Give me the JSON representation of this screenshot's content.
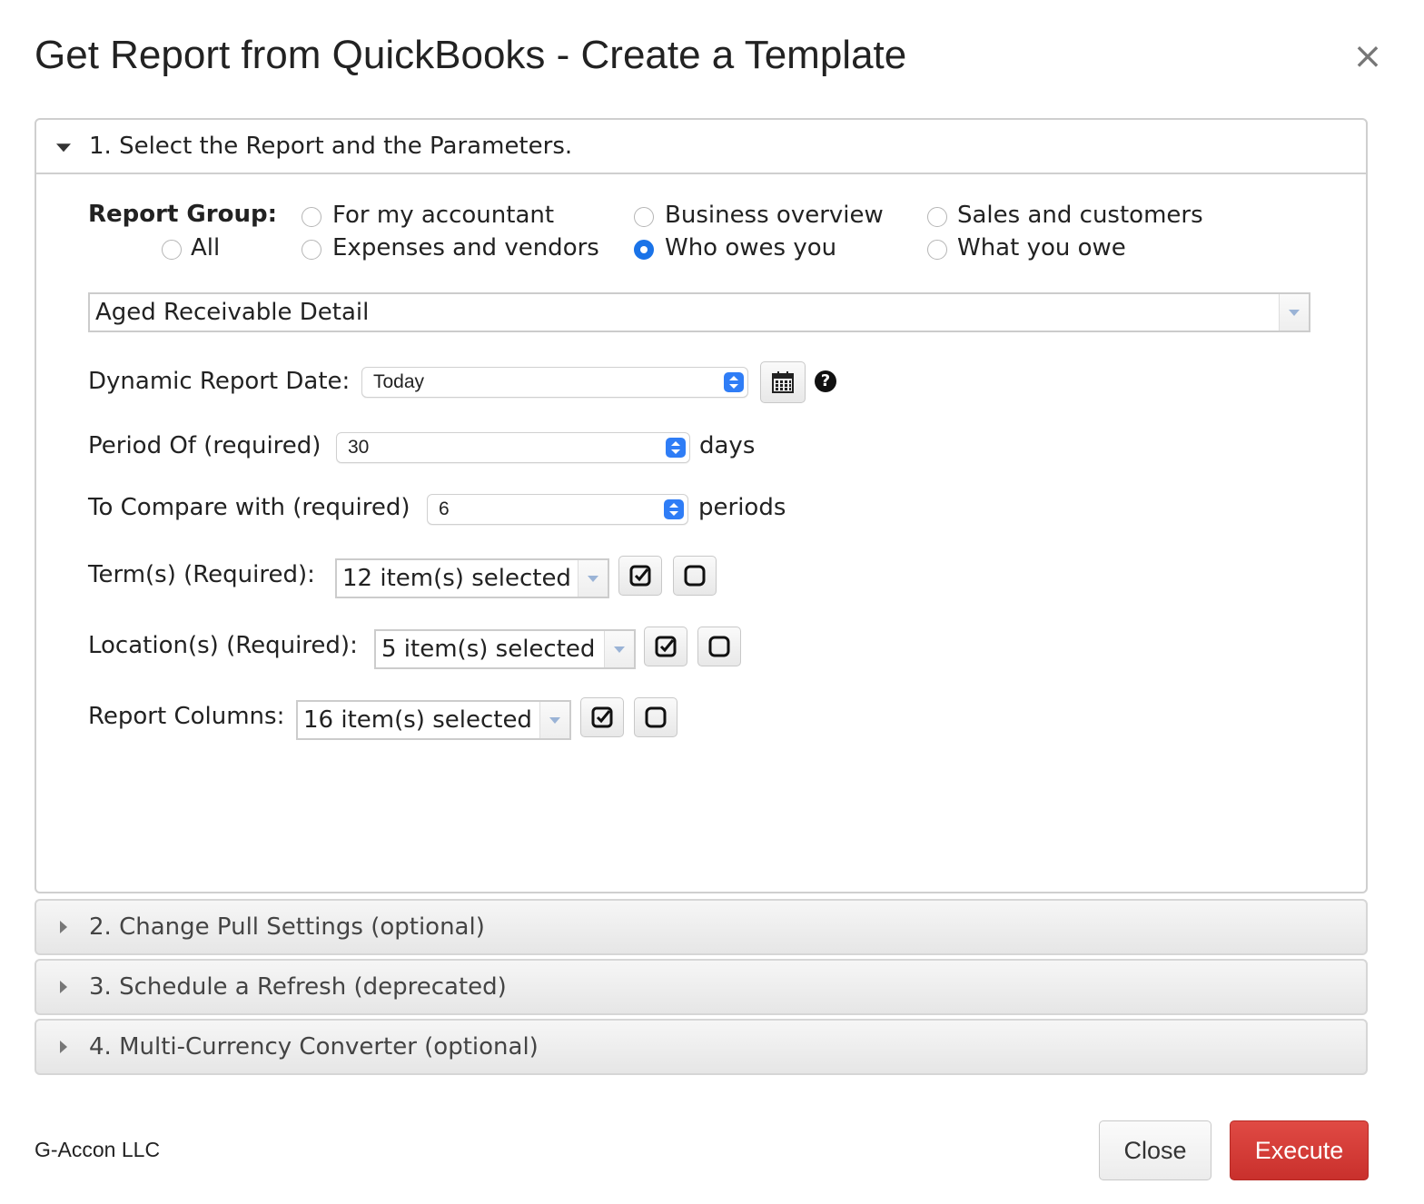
{
  "dialog": {
    "title": "Get Report from QuickBooks - Create a Template",
    "close_icon": "close-icon"
  },
  "section1": {
    "header": "1. Select the Report and the Parameters.",
    "report_group_label": "Report Group:",
    "report_groups": [
      {
        "label": "All",
        "checked": false
      },
      {
        "label": "For my accountant",
        "checked": false
      },
      {
        "label": "Expenses and vendors",
        "checked": false
      },
      {
        "label": "Business overview",
        "checked": false
      },
      {
        "label": "Who owes you",
        "checked": true
      },
      {
        "label": "Sales and customers",
        "checked": false
      },
      {
        "label": "What you owe",
        "checked": false
      }
    ],
    "report_select": "Aged Receivable Detail",
    "dynamic_date_label": "Dynamic Report Date:",
    "dynamic_date_value": "Today",
    "period_label": "Period Of (required)",
    "period_value": "30",
    "period_unit": "days",
    "compare_label": "To Compare with (required)",
    "compare_value": "6",
    "compare_unit": "periods",
    "terms_label": "Term(s) (Required):",
    "terms_value": "12 item(s) selected",
    "locations_label": "Location(s) (Required):",
    "locations_value": "5 item(s) selected",
    "columns_label": "Report Columns:",
    "columns_value": "16 item(s) selected",
    "help_glyph": "?"
  },
  "section2": {
    "header": "2. Change Pull Settings (optional)"
  },
  "section3": {
    "header": "3. Schedule a Refresh (deprecated)"
  },
  "section4": {
    "header": "4. Multi-Currency Converter (optional)"
  },
  "footer": {
    "company": "G-Accon LLC",
    "close_label": "Close",
    "execute_label": "Execute"
  },
  "colors": {
    "accent": "#1a73e8",
    "execute": "#c9302c"
  }
}
